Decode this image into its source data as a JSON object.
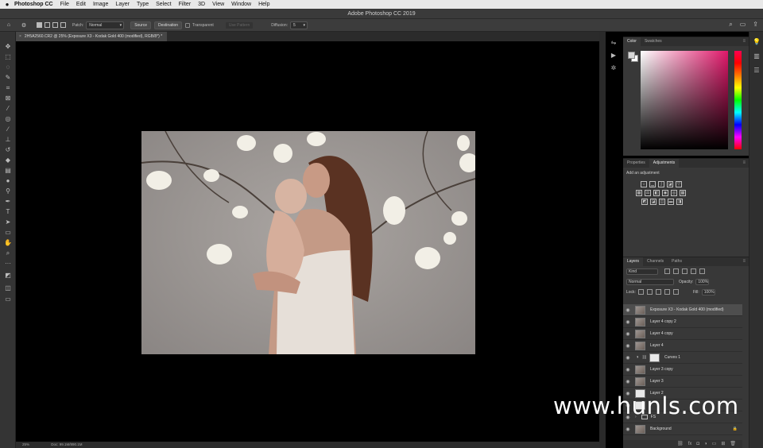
{
  "menubar": {
    "app_name": "Photoshop CC",
    "items": [
      "File",
      "Edit",
      "Image",
      "Layer",
      "Type",
      "Select",
      "Filter",
      "3D",
      "View",
      "Window",
      "Help"
    ]
  },
  "window": {
    "title": "Adobe Photoshop CC 2019"
  },
  "options": {
    "patch_label": "Patch:",
    "patch_value": "Normal",
    "source_label": "Source",
    "destination_label": "Destination",
    "transparent_label": "Transparent",
    "use_pattern_label": "Use Pattern",
    "diffusion_label": "Diffusion:",
    "diffusion_value": "5"
  },
  "document": {
    "tab_title": "2H5A2560.CR2 @ 25% (Exposure X3 - Kodak Gold 400 (modified), RGB/8*) *"
  },
  "status": {
    "zoom": "25%",
    "doc_info": "Doc: 99.1M/890.1M"
  },
  "color_panel": {
    "tabs": [
      "Color",
      "Swatches"
    ],
    "fg_color": "#d8d8d8",
    "bg_color": "#ffffff",
    "hue_color": "#e0186a"
  },
  "adjustments_panel": {
    "tabs": [
      "Properties",
      "Adjustments"
    ],
    "label": "Add an adjustment"
  },
  "layers_panel": {
    "tabs": [
      "Layers",
      "Channels",
      "Paths"
    ],
    "filter_kind": "Kind",
    "blend_mode": "Normal",
    "opacity_label": "Opacity:",
    "opacity_value": "100%",
    "lock_label": "Lock:",
    "fill_label": "Fill:",
    "fill_value": "100%",
    "layers": [
      {
        "name": "Exposure X3 - Kodak Gold 400 (modified)"
      },
      {
        "name": "Layer 4 copy 2"
      },
      {
        "name": "Layer 4 copy"
      },
      {
        "name": "Layer 4"
      },
      {
        "name": "Curves 1"
      },
      {
        "name": "Layer 3 copy"
      },
      {
        "name": "Layer 3"
      },
      {
        "name": "Layer 2"
      },
      {
        "name": ""
      },
      {
        "name": "FS"
      },
      {
        "name": "Background"
      }
    ]
  },
  "watermark": "www.hunls.com"
}
